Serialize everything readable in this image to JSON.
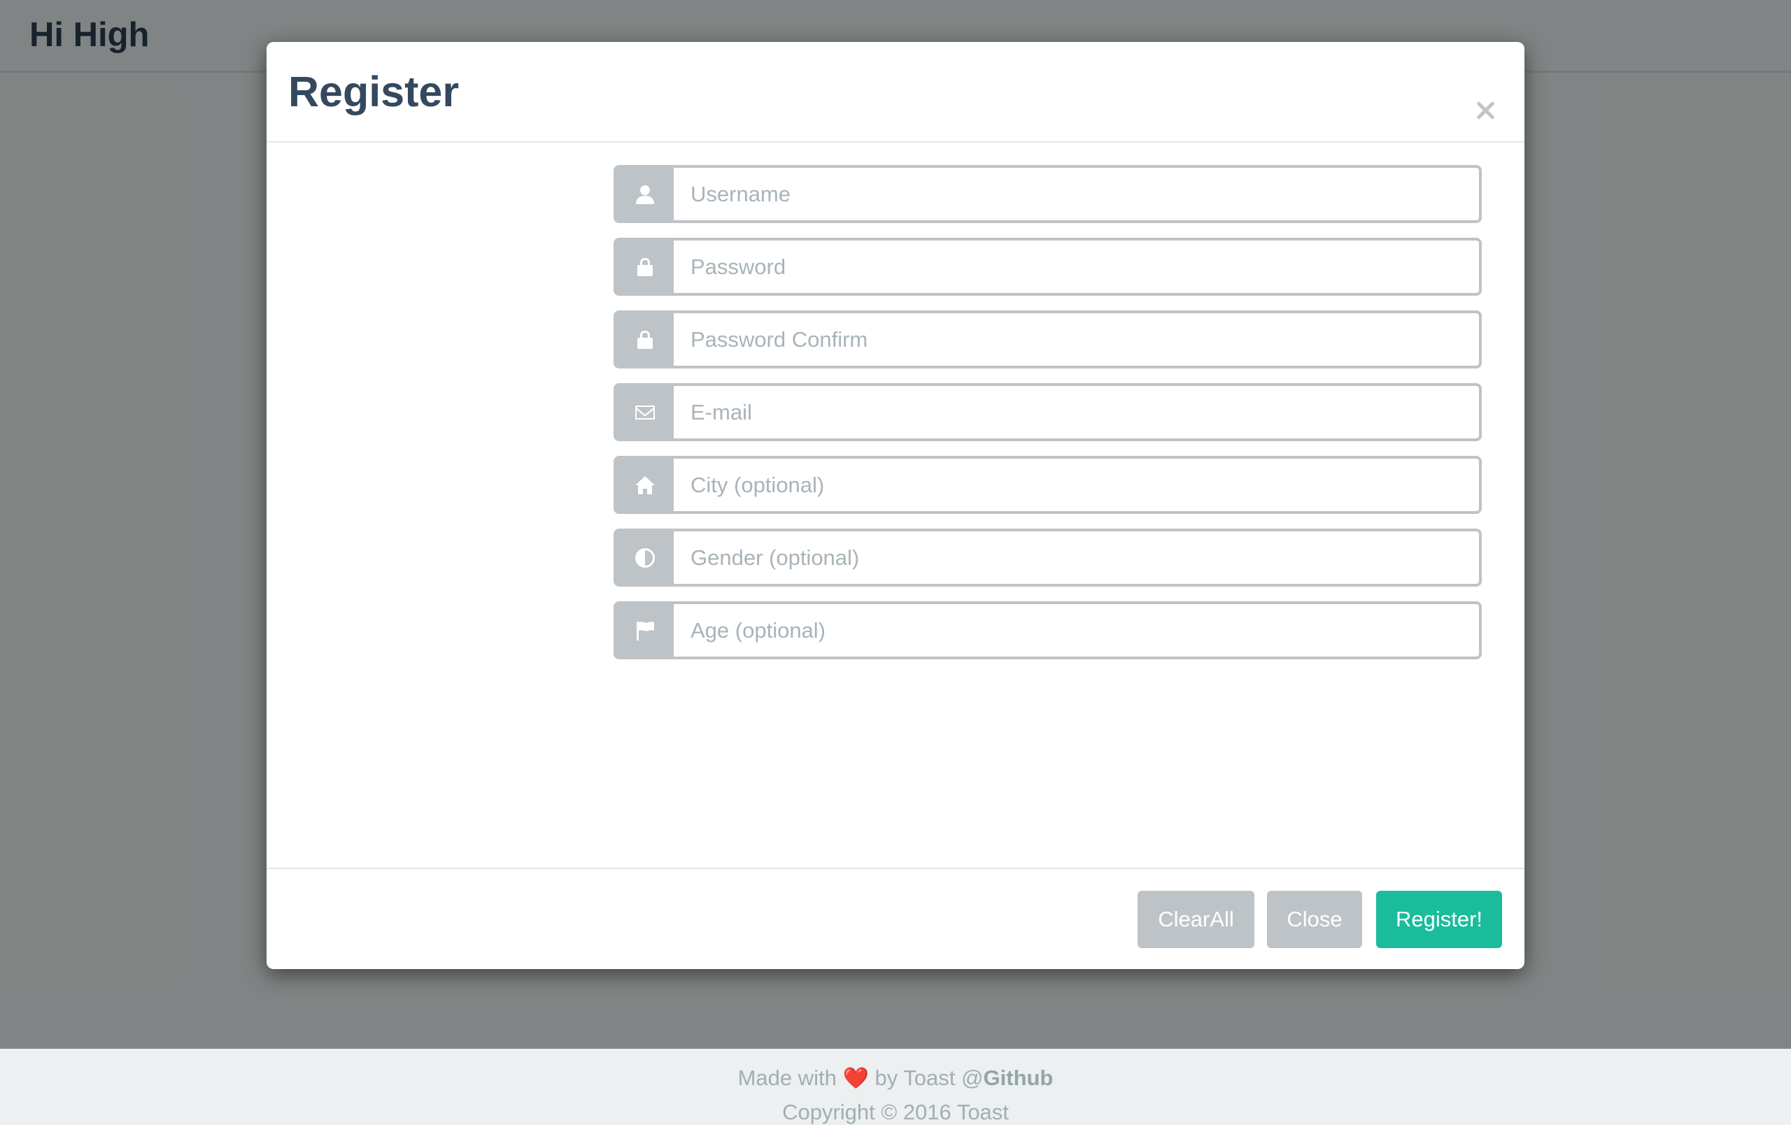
{
  "navbar": {
    "brand": "Hi High"
  },
  "modal": {
    "title": "Register",
    "close_icon": "close-icon",
    "fields": [
      {
        "placeholder": "Username",
        "value": "",
        "icon": "user-icon"
      },
      {
        "placeholder": "Password",
        "value": "",
        "icon": "lock-icon"
      },
      {
        "placeholder": "Password Confirm",
        "value": "",
        "icon": "lock-icon"
      },
      {
        "placeholder": "E-mail",
        "value": "",
        "icon": "envelope-icon"
      },
      {
        "placeholder": "City (optional)",
        "value": "",
        "icon": "home-icon"
      },
      {
        "placeholder": "Gender (optional)",
        "value": "",
        "icon": "contrast-icon"
      },
      {
        "placeholder": "Age (optional)",
        "value": "",
        "icon": "flag-icon"
      }
    ],
    "buttons": {
      "clear_all": "ClearAll",
      "close": "Close",
      "register": "Register!"
    }
  },
  "footer": {
    "made_with": "Made with",
    "heart": "❤️",
    "by": "by Toast",
    "at": "@",
    "github": "Github",
    "copyright": "Copyright © 2016 Toast"
  },
  "colors": {
    "primary": "#1abc9c",
    "muted": "#bdc3c7",
    "heading": "#34495e",
    "page_bg": "#ecf0f1"
  }
}
